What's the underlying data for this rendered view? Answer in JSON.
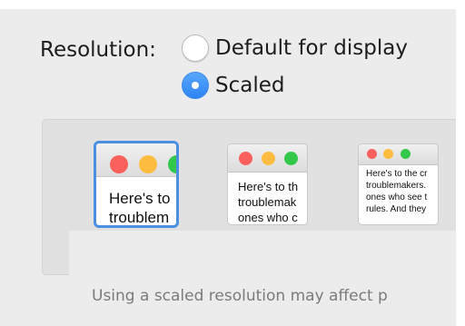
{
  "resolution": {
    "label": "Resolution:",
    "options": [
      {
        "label": "Default for display",
        "selected": false
      },
      {
        "label": "Scaled",
        "selected": true
      }
    ]
  },
  "previews": [
    {
      "lines": [
        "Here's to",
        "troublem"
      ],
      "selected": true
    },
    {
      "lines": [
        "Here's to th",
        "troublemak",
        "ones who c"
      ],
      "selected": false
    },
    {
      "lines": [
        "Here's to the cr",
        "troublemakers.",
        "ones who see t",
        "rules. And they"
      ],
      "selected": false
    }
  ],
  "note": "Using a scaled resolution may affect p",
  "colors": {
    "accent": "#4a8fe2",
    "radio_selected": "#2d84f4",
    "traffic_red": "#fc605c",
    "traffic_yellow": "#fdbc40",
    "traffic_green": "#34c84a"
  }
}
